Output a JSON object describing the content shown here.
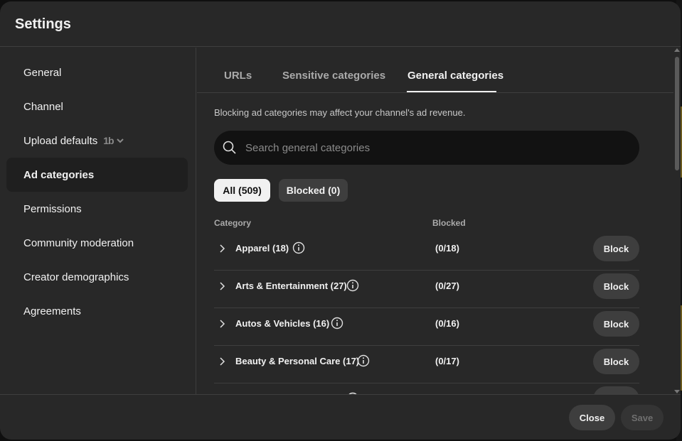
{
  "dialog": {
    "title": "Settings"
  },
  "sidebar": {
    "items": [
      {
        "label": "General",
        "active": false
      },
      {
        "label": "Channel",
        "active": false
      },
      {
        "label": "Upload defaults",
        "active": false
      },
      {
        "label": "Ad categories",
        "active": true
      },
      {
        "label": "Permissions",
        "active": false
      },
      {
        "label": "Community moderation",
        "active": false
      },
      {
        "label": "Creator demographics",
        "active": false
      },
      {
        "label": "Agreements",
        "active": false
      }
    ],
    "upload_badge": "1b"
  },
  "tabs": [
    {
      "label": "URLs",
      "active": false
    },
    {
      "label": "Sensitive categories",
      "active": false
    },
    {
      "label": "General categories",
      "active": true
    }
  ],
  "content": {
    "info_text": "Blocking ad categories may affect your channel's ad revenue.",
    "search_placeholder": "Search general categories",
    "chips": [
      {
        "label": "All (509)",
        "active": true
      },
      {
        "label": "Blocked (0)",
        "active": false
      }
    ],
    "columns": {
      "category": "Category",
      "blocked": "Blocked"
    },
    "rows": [
      {
        "name": "Apparel (18)",
        "blocked": "(0/18)",
        "action": "Block"
      },
      {
        "name": "Arts & Entertainment (27)",
        "blocked": "(0/27)",
        "action": "Block"
      },
      {
        "name": "Autos & Vehicles (16)",
        "blocked": "(0/16)",
        "action": "Block"
      },
      {
        "name": "Beauty & Personal Care (17)",
        "blocked": "(0/17)",
        "action": "Block"
      }
    ]
  },
  "footer": {
    "close_label": "Close",
    "save_label": "Save"
  },
  "colors": {
    "dialog_bg": "#282828",
    "active_chip_bg": "#f1f1f1",
    "button_bg": "#3e3e3e"
  }
}
